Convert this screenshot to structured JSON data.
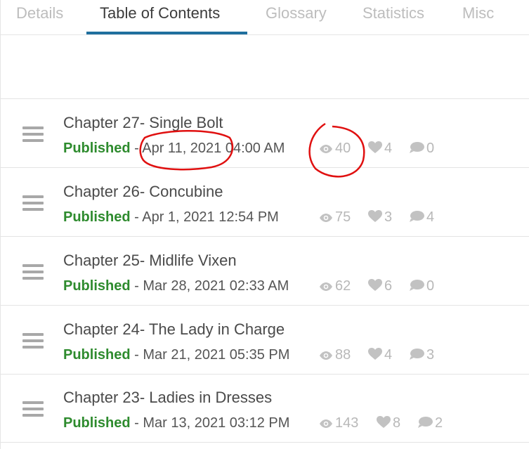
{
  "tabs": [
    {
      "label": "Details"
    },
    {
      "label": "Table of Contents"
    },
    {
      "label": "Glossary"
    },
    {
      "label": "Statistics"
    },
    {
      "label": "Misc"
    }
  ],
  "chapters": [
    {
      "title": "Chapter 27- Single Bolt",
      "status": "Published",
      "separator": " - ",
      "date": "Apr 11, 2021 04:00 AM",
      "views": "40",
      "likes": "4",
      "comments": "0"
    },
    {
      "title": "Chapter 26- Concubine",
      "status": "Published",
      "separator": " - ",
      "date": "Apr 1, 2021 12:54 PM",
      "views": "75",
      "likes": "3",
      "comments": "4"
    },
    {
      "title": "Chapter 25- Midlife Vixen",
      "status": "Published",
      "separator": " - ",
      "date": "Mar 28, 2021 02:33 AM",
      "views": "62",
      "likes": "6",
      "comments": "0"
    },
    {
      "title": "Chapter 24- The Lady in Charge",
      "status": "Published",
      "separator": " - ",
      "date": "Mar 21, 2021 05:35 PM",
      "views": "88",
      "likes": "4",
      "comments": "3"
    },
    {
      "title": "Chapter 23- Ladies in Dresses",
      "status": "Published",
      "separator": " - ",
      "date": "Mar 13, 2021 03:12 PM",
      "views": "143",
      "likes": "8",
      "comments": "2"
    }
  ],
  "colors": {
    "published": "#2e8b2e",
    "active_tab_underline": "#1f6f9e",
    "annotation": "#e01010"
  },
  "icons": {
    "views": "eye-icon",
    "likes": "heart-icon",
    "comments": "comment-icon",
    "handle": "drag-handle-icon"
  }
}
